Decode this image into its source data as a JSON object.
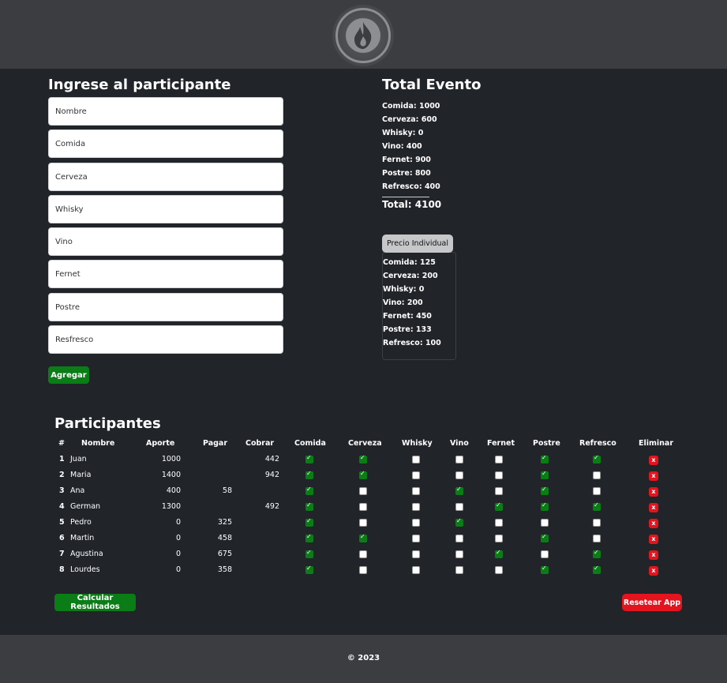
{
  "header": {
    "logo_icon": "grill-split-flame-logo"
  },
  "form": {
    "title": "Ingrese al participante",
    "fields": [
      {
        "placeholder": "Nombre"
      },
      {
        "placeholder": "Comida"
      },
      {
        "placeholder": "Cerveza"
      },
      {
        "placeholder": "Whisky"
      },
      {
        "placeholder": "Vino"
      },
      {
        "placeholder": "Fernet"
      },
      {
        "placeholder": "Postre"
      },
      {
        "placeholder": "Resfresco"
      }
    ],
    "add_label": "Agregar"
  },
  "totals": {
    "title": "Total Evento",
    "lines": [
      "Comida: 1000",
      "Cerveza: 600",
      "Whisky: 0",
      "Vino: 400",
      "Fernet: 900",
      "Postre: 800",
      "Refresco: 400"
    ],
    "total": "Total: 4100"
  },
  "individual": {
    "button_label": "Precio Individual",
    "lines": [
      "Comida: 125",
      "Cerveza: 200",
      "Whisky: 0",
      "Vino: 200",
      "Fernet: 450",
      "Postre: 133",
      "Refresco: 100"
    ]
  },
  "participants": {
    "title": "Participantes",
    "headers": [
      "#",
      "Nombre",
      "Aporte",
      "Pagar",
      "Cobrar",
      "Comida",
      "Cerveza",
      "Whisky",
      "Vino",
      "Fernet",
      "Postre",
      "Refresco",
      "Eliminar"
    ],
    "rows": [
      {
        "n": "1",
        "nombre": "Juan",
        "aporte": "1000",
        "pagar": "",
        "cobrar": "442",
        "checks": [
          true,
          true,
          false,
          false,
          false,
          true,
          true
        ]
      },
      {
        "n": "2",
        "nombre": "Maria",
        "aporte": "1400",
        "pagar": "",
        "cobrar": "942",
        "checks": [
          true,
          true,
          false,
          false,
          false,
          true,
          false
        ]
      },
      {
        "n": "3",
        "nombre": "Ana",
        "aporte": "400",
        "pagar": "58",
        "cobrar": "",
        "checks": [
          true,
          false,
          false,
          true,
          false,
          true,
          false
        ]
      },
      {
        "n": "4",
        "nombre": "German",
        "aporte": "1300",
        "pagar": "",
        "cobrar": "492",
        "checks": [
          true,
          false,
          false,
          false,
          true,
          true,
          true
        ]
      },
      {
        "n": "5",
        "nombre": "Pedro",
        "aporte": "0",
        "pagar": "325",
        "cobrar": "",
        "checks": [
          true,
          false,
          false,
          true,
          false,
          false,
          false
        ]
      },
      {
        "n": "6",
        "nombre": "Martin",
        "aporte": "0",
        "pagar": "458",
        "cobrar": "",
        "checks": [
          true,
          true,
          false,
          false,
          false,
          true,
          false
        ]
      },
      {
        "n": "7",
        "nombre": "Agustina",
        "aporte": "0",
        "pagar": "675",
        "cobrar": "",
        "checks": [
          true,
          false,
          false,
          false,
          true,
          false,
          true
        ]
      },
      {
        "n": "8",
        "nombre": "Lourdes",
        "aporte": "0",
        "pagar": "358",
        "cobrar": "",
        "checks": [
          true,
          false,
          false,
          false,
          false,
          true,
          true
        ]
      }
    ],
    "delete_label": "x",
    "calc_label": "Calcular Resultados",
    "reset_label": "Resetear App"
  },
  "footer": {
    "text": "© 2023"
  },
  "colors": {
    "green": "#0a7d16",
    "red": "#e4141f",
    "bg": "#212429",
    "bar": "#3b3d40"
  }
}
